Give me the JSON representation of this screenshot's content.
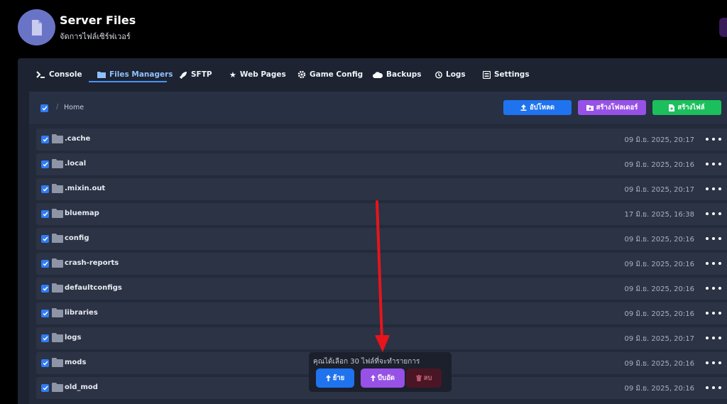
{
  "header": {
    "title": "Server Files",
    "subtitle": "จัดการไฟล์เซิร์ฟเวอร์",
    "icon": "file-icon"
  },
  "tabs": [
    {
      "label": "Console",
      "icon": "terminal-icon"
    },
    {
      "label": "Files Managers",
      "icon": "folder-icon",
      "active": true
    },
    {
      "label": "SFTP",
      "icon": "rocket-icon"
    },
    {
      "label": "Web Pages",
      "icon": "star-icon"
    },
    {
      "label": "Game Config",
      "icon": "gear-icon"
    },
    {
      "label": "Backups",
      "icon": "cloud-icon"
    },
    {
      "label": "Logs",
      "icon": "history-icon"
    },
    {
      "label": "Settings",
      "icon": "settings-icon"
    }
  ],
  "toolbar": {
    "breadcrumb_sep": "/",
    "breadcrumb": "Home",
    "upload_label": "อัปโหลด",
    "create_folder_label": "สร้างโฟลเดอร์",
    "create_file_label": "สร้างไฟล์"
  },
  "files": [
    {
      "name": ".cache",
      "date": "09 มิ.ย. 2025, 20:17"
    },
    {
      "name": ".local",
      "date": "09 มิ.ย. 2025, 20:16"
    },
    {
      "name": ".mixin.out",
      "date": "09 มิ.ย. 2025, 20:17"
    },
    {
      "name": "bluemap",
      "date": "17 มิ.ย. 2025, 16:38"
    },
    {
      "name": "config",
      "date": "09 มิ.ย. 2025, 20:16"
    },
    {
      "name": "crash-reports",
      "date": "09 มิ.ย. 2025, 20:16"
    },
    {
      "name": "defaultconfigs",
      "date": "09 มิ.ย. 2025, 20:16"
    },
    {
      "name": "libraries",
      "date": "09 มิ.ย. 2025, 20:16"
    },
    {
      "name": "logs",
      "date": "09 มิ.ย. 2025, 20:17"
    },
    {
      "name": "mods",
      "date": "09 มิ.ย. 2025, 20:16"
    },
    {
      "name": "old_mod",
      "date": "09 มิ.ย. 2025, 20:16"
    }
  ],
  "selection": {
    "text": "คุณได้เลือก 30 ไฟล์ที่จะทำรายการ",
    "move_label": "ย้าย",
    "zip_label": "บีบอัด",
    "delete_label": "ลบ"
  },
  "colors": {
    "accent": "#2f7cf6",
    "purple": "#9751e6",
    "green": "#1bbf5c",
    "annotation": "#e8141b"
  }
}
